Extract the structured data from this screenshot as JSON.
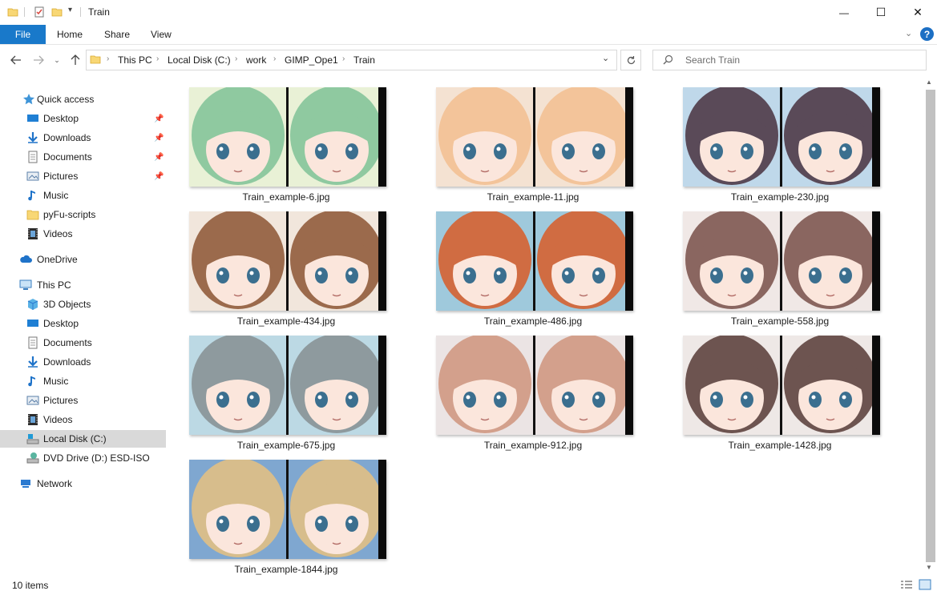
{
  "window": {
    "title": "Train",
    "minimize_glyph": "—",
    "maximize_glyph": "☐",
    "close_glyph": "✕"
  },
  "ribbon": {
    "tabs": [
      "File",
      "Home",
      "Share",
      "View"
    ],
    "help_glyph": "?"
  },
  "address": {
    "crumbs": [
      "This PC",
      "Local Disk (C:)",
      "work",
      "GIMP_Ope1",
      "Train"
    ]
  },
  "search": {
    "placeholder": "Search Train"
  },
  "navpane": {
    "quick_access": "Quick access",
    "quick_items": [
      {
        "label": "Desktop",
        "icon": "desktop-icon"
      },
      {
        "label": "Downloads",
        "icon": "downloads-icon"
      },
      {
        "label": "Documents",
        "icon": "documents-icon"
      },
      {
        "label": "Pictures",
        "icon": "pictures-icon"
      },
      {
        "label": "Music",
        "icon": "music-icon"
      },
      {
        "label": "pyFu-scripts",
        "icon": "folder-icon"
      },
      {
        "label": "Videos",
        "icon": "videos-icon"
      }
    ],
    "onedrive": "OneDrive",
    "this_pc": "This PC",
    "pc_items": [
      {
        "label": "3D Objects",
        "icon": "3d-objects-icon"
      },
      {
        "label": "Desktop",
        "icon": "desktop-icon"
      },
      {
        "label": "Documents",
        "icon": "documents-icon"
      },
      {
        "label": "Downloads",
        "icon": "downloads-icon"
      },
      {
        "label": "Music",
        "icon": "music-icon"
      },
      {
        "label": "Pictures",
        "icon": "pictures-icon"
      },
      {
        "label": "Videos",
        "icon": "videos-icon"
      },
      {
        "label": "Local Disk (C:)",
        "icon": "local-disk-icon"
      },
      {
        "label": "DVD Drive (D:) ESD-ISO",
        "icon": "dvd-drive-icon"
      }
    ],
    "network": "Network"
  },
  "files": [
    {
      "name": "Train_example-6.jpg",
      "hair": "#8fc9a0",
      "bg": "#e9f1d6"
    },
    {
      "name": "Train_example-11.jpg",
      "hair": "#f3c49a",
      "bg": "#f4e2d2"
    },
    {
      "name": "Train_example-230.jpg",
      "hair": "#5a4a58",
      "bg": "#bfd8ea"
    },
    {
      "name": "Train_example-434.jpg",
      "hair": "#9b6a4c",
      "bg": "#f1e6dc"
    },
    {
      "name": "Train_example-486.jpg",
      "hair": "#d06c42",
      "bg": "#9fc9dc"
    },
    {
      "name": "Train_example-558.jpg",
      "hair": "#8a6660",
      "bg": "#f0e8e6"
    },
    {
      "name": "Train_example-675.jpg",
      "hair": "#8e9a9e",
      "bg": "#bcd9e4"
    },
    {
      "name": "Train_example-912.jpg",
      "hair": "#d3a08c",
      "bg": "#ebe4e4"
    },
    {
      "name": "Train_example-1428.jpg",
      "hair": "#6d5450",
      "bg": "#eee8e6"
    },
    {
      "name": "Train_example-1844.jpg",
      "hair": "#d7bd8c",
      "bg": "#7fa7d0"
    }
  ],
  "status": {
    "count": "10 items"
  }
}
